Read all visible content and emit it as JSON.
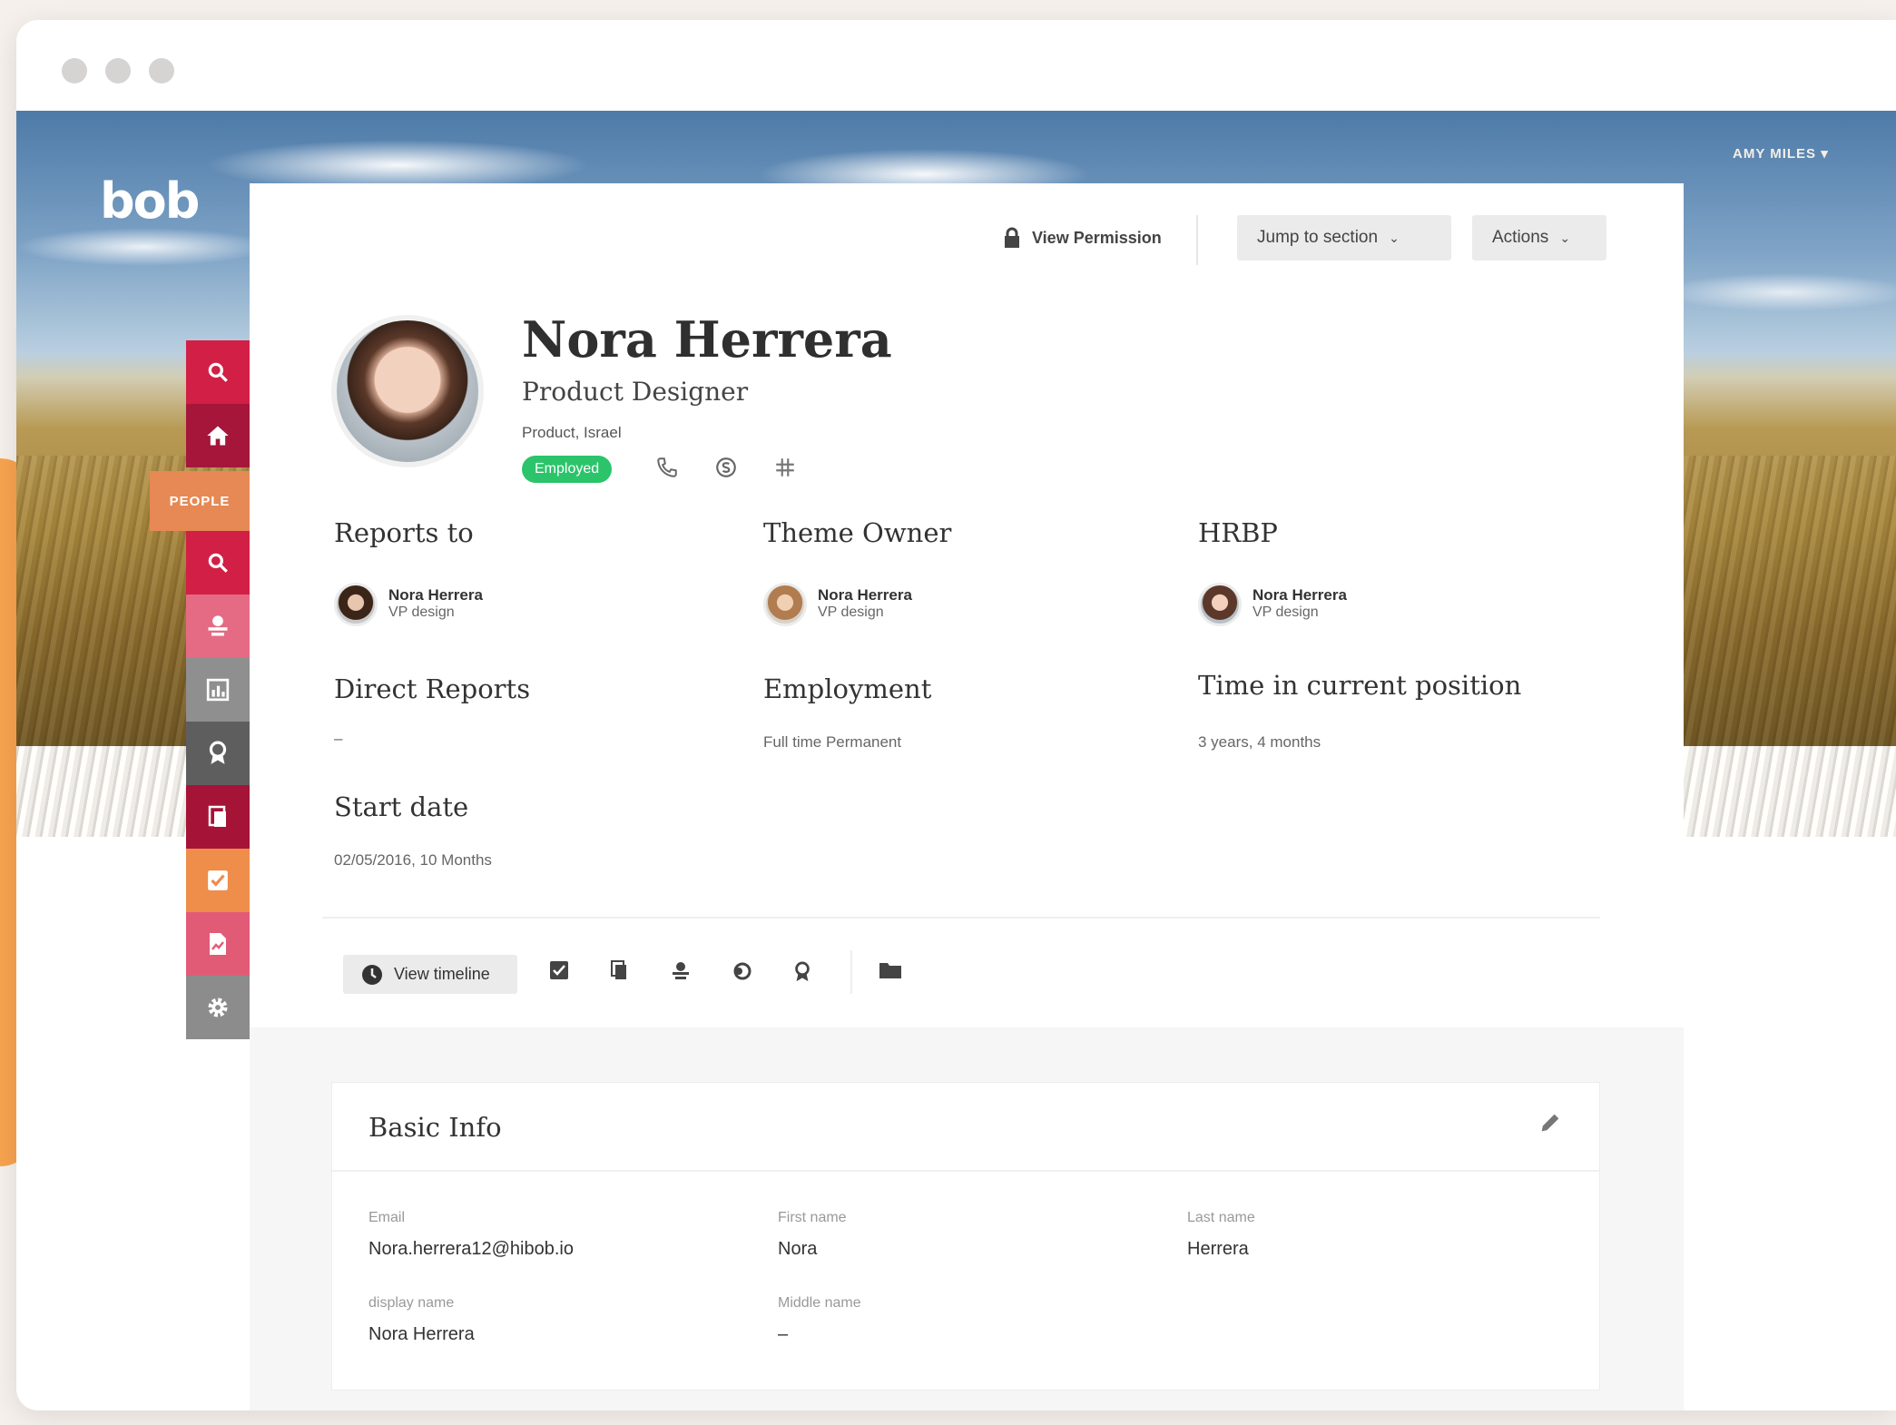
{
  "window": {
    "controls": [
      "close",
      "minimize",
      "maximize"
    ]
  },
  "brand": {
    "logo": "bob"
  },
  "header": {
    "user_menu": "AMY MILES ▾"
  },
  "sidebar": {
    "people_label": "PEOPLE",
    "items": [
      {
        "icon": "search-icon",
        "color": "#d21f45"
      },
      {
        "icon": "home-icon",
        "color": "#a5163a"
      },
      {
        "icon": "search-icon",
        "color": "#d21f45"
      },
      {
        "icon": "org-icon",
        "color": "#e56b84"
      },
      {
        "icon": "chart-icon",
        "color": "#8f8f8f"
      },
      {
        "icon": "award-icon",
        "color": "#5e5e5e"
      },
      {
        "icon": "docs-icon",
        "color": "#a51337"
      },
      {
        "icon": "tasks-icon",
        "color": "#ef8d4b"
      },
      {
        "icon": "report-icon",
        "color": "#e15b77"
      },
      {
        "icon": "settings-icon",
        "color": "#8c8c8c"
      }
    ]
  },
  "toolbar": {
    "view_permission": "View Permission",
    "jump_to_section": "Jump to section",
    "actions": "Actions"
  },
  "profile": {
    "name": "Nora Herrera",
    "title": "Product Designer",
    "department": "Product, Israel",
    "status": "Employed",
    "status_color": "#2bc46b",
    "contact_icons": [
      "phone-icon",
      "skype-icon",
      "slack-icon"
    ]
  },
  "relations": {
    "reports_to": {
      "label": "Reports to",
      "name": "Nora Herrera",
      "title": "VP design"
    },
    "theme_owner": {
      "label": "Theme Owner",
      "name": "Nora Herrera",
      "title": "VP design"
    },
    "hrbp": {
      "label": "HRBP",
      "name": "Nora Herrera",
      "title": "VP design"
    }
  },
  "details": {
    "direct_reports": {
      "label": "Direct Reports",
      "value": "–"
    },
    "employment": {
      "label": "Employment",
      "value": "Full time Permanent"
    },
    "time_in_position": {
      "label": "Time in current position",
      "value": "3 years, 4 months"
    },
    "start_date": {
      "label": "Start date",
      "value": "02/05/2016, 10 Months"
    }
  },
  "timeline": {
    "button": "View timeline",
    "icons": [
      "checkbox-icon",
      "docs-icon",
      "org-icon",
      "history-icon",
      "award-icon",
      "folder-icon"
    ]
  },
  "basic_info": {
    "title": "Basic Info",
    "fields": {
      "email": {
        "label": "Email",
        "value": "Nora.herrera12@hibob.io"
      },
      "first_name": {
        "label": "First name",
        "value": "Nora"
      },
      "last_name": {
        "label": "Last name",
        "value": "Herrera"
      },
      "display_name": {
        "label": "display name",
        "value": "Nora Herrera"
      },
      "middle_name": {
        "label": "Middle name",
        "value": "–"
      }
    }
  }
}
